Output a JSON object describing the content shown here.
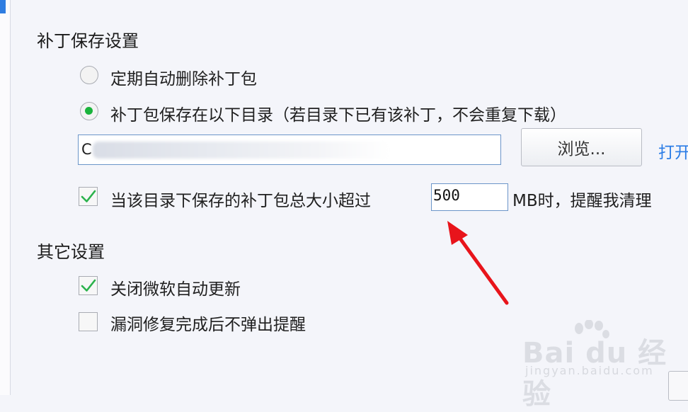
{
  "patch_section": {
    "title": "补丁保存设置",
    "option_auto_delete": "定期自动删除补丁包",
    "option_save_dir": "补丁包保存在以下目录（若目录下已有该补丁，不会重复下载）",
    "path_value": "C",
    "browse_label": "浏览...",
    "open_link": "打开",
    "size_check_label": "当该目录下保存的补丁包总大小超过",
    "size_value": "500",
    "size_unit_suffix": "MB时，提醒我清理"
  },
  "other_section": {
    "title": "其它设置",
    "disable_ms_update": "关闭微软自动更新",
    "no_popup_after_fix": "漏洞修复完成后不弹出提醒"
  },
  "watermark": {
    "main": "Bai du 经验",
    "sub": "jingyan.baidu.com"
  },
  "colors": {
    "accent_blue": "#2f7de1",
    "radio_green": "#19b33b",
    "check_green": "#2bb24c",
    "arrow_red": "#e8141b",
    "link_blue": "#2b7de6"
  }
}
